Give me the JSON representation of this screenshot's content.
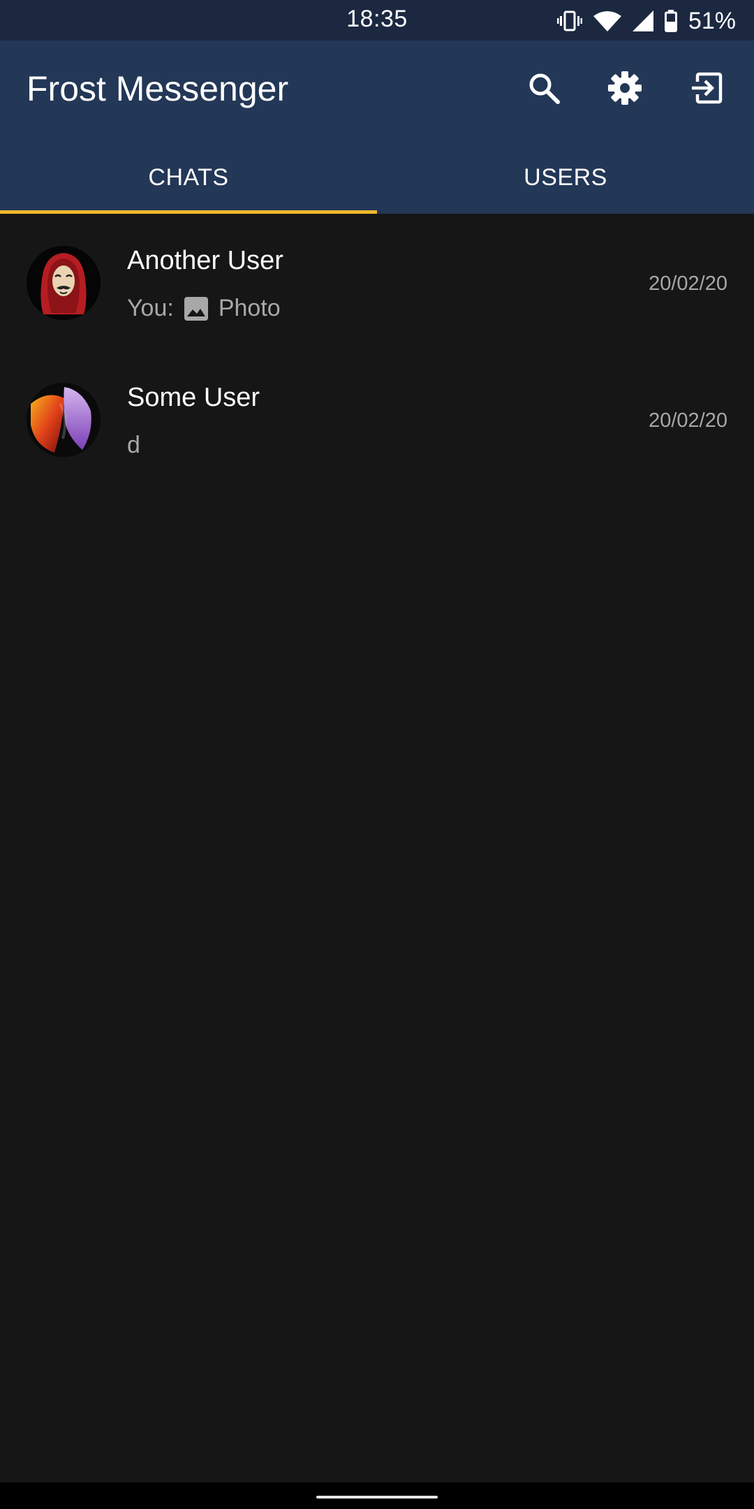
{
  "status_bar": {
    "time": "18:35",
    "battery_percent": "51%",
    "icons": [
      "vibrate-icon",
      "wifi-icon",
      "signal-icon",
      "battery-icon"
    ]
  },
  "app_bar": {
    "title": "Frost Messenger",
    "actions": [
      "search-icon",
      "settings-gear-icon",
      "logout-icon"
    ]
  },
  "tabs": [
    {
      "label": "CHATS",
      "active": true
    },
    {
      "label": "USERS",
      "active": false
    }
  ],
  "chats": [
    {
      "name": "Another User",
      "preview_prefix": "You:",
      "preview_icon": "photo-icon",
      "preview_text": "Photo",
      "date": "20/02/20",
      "avatar": "mask-avatar"
    },
    {
      "name": "Some User",
      "preview_prefix": "",
      "preview_text": "d",
      "date": "20/02/20",
      "avatar": "abstract-avatar"
    }
  ],
  "colors": {
    "status_bar": "#1b2840",
    "app_bar": "#233757",
    "tab_indicator": "#f0b92d",
    "background": "#161616",
    "secondary_text": "#a8a8a8"
  }
}
